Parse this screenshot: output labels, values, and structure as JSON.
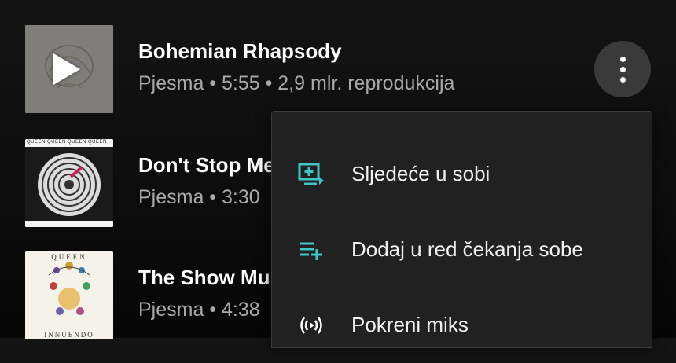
{
  "songs": [
    {
      "title": "Bohemian Rhapsody",
      "meta": "Pjesma • 5:55 • 2,9 mlr. reprodukcija"
    },
    {
      "title": "Don't Stop Me",
      "meta": "Pjesma • 3:30",
      "thumb_text": "QUEEN QUEEN QUEEN QUEEN"
    },
    {
      "title": "The Show Mu",
      "meta": "Pjesma • 4:38",
      "thumb_top": "QUEEN",
      "thumb_bottom": "INNUENDO"
    }
  ],
  "menu": {
    "items": [
      {
        "label": "Sljedeće u sobi",
        "icon": "play-next-in-room-icon"
      },
      {
        "label": "Dodaj u red čekanja sobe",
        "icon": "add-to-queue-icon"
      },
      {
        "label": "Pokreni miks",
        "icon": "radio-mix-icon"
      }
    ]
  },
  "colors": {
    "accent": "#3fc6c6",
    "menu_bg": "#212121",
    "button_bg": "#3a3a3a"
  }
}
